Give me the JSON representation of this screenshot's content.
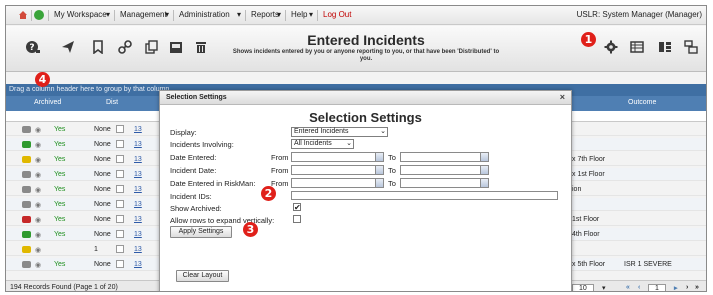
{
  "menu": {
    "items": [
      "My Workspace",
      "Management",
      "Administration",
      "Reports",
      "Help",
      "Log Out"
    ],
    "user": "USLR: System Manager (Manager)"
  },
  "toolbar": {
    "icons": [
      "help-icon",
      "send-icon",
      "bookmark-icon",
      "link-icon",
      "copy-icon",
      "inbox-icon",
      "delete-icon",
      "settings-icon",
      "grid-view-icon",
      "card-view-icon",
      "split-view-icon"
    ],
    "title": "Entered Incidents",
    "subtitle": "Shows incidents entered by you or anyone reporting to you, or that have been 'Distributed' to you."
  },
  "grid": {
    "group_hint": "Drag a column header here to group by that column",
    "columns": [
      "Archived",
      "Dist",
      "Outcome"
    ],
    "rows": [
      {
        "archived": "Yes",
        "dist": "None",
        "id": "13",
        "location": "",
        "outcome": "",
        "status": "gray"
      },
      {
        "archived": "Yes",
        "dist": "None",
        "id": "13",
        "location": "",
        "outcome": "",
        "status": "green"
      },
      {
        "archived": "Yes",
        "dist": "None",
        "id": "13",
        "location": "x 7th Floor",
        "outcome": "",
        "status": "yellow"
      },
      {
        "archived": "Yes",
        "dist": "None",
        "id": "13",
        "location": "x 1st Floor",
        "outcome": "",
        "status": "gray"
      },
      {
        "archived": "Yes",
        "dist": "None",
        "id": "13",
        "location": "ion",
        "outcome": "",
        "status": "gray"
      },
      {
        "archived": "Yes",
        "dist": "None",
        "id": "13",
        "location": "",
        "outcome": "",
        "status": "gray"
      },
      {
        "archived": "Yes",
        "dist": "None",
        "id": "13",
        "location": "1st Floor",
        "outcome": "",
        "status": "red"
      },
      {
        "archived": "Yes",
        "dist": "None",
        "id": "13",
        "location": "4th Floor",
        "outcome": "",
        "status": "green"
      },
      {
        "archived": "",
        "dist": "1",
        "id": "13",
        "location": "",
        "outcome": "",
        "status": "yellow"
      },
      {
        "archived": "Yes",
        "dist": "None",
        "id": "13",
        "location": "x 5th Floor",
        "outcome": "ISR 1 SEVERE",
        "status": "gray"
      }
    ],
    "footer_count": "194 Records Found (Page 1 of 20)",
    "page_size": "10",
    "current_page": "1"
  },
  "modal": {
    "header": "Selection Settings",
    "close": "×",
    "title": "Selection Settings",
    "fields": {
      "display_label": "Display:",
      "display_value": "Entered Incidents",
      "involving_label": "Incidents Involving:",
      "involving_value": "All Incidents",
      "date_entered_label": "Date Entered:",
      "incident_date_label": "Incident Date:",
      "date_riskman_label": "Date Entered in RiskMan:",
      "from": "From",
      "to": "To",
      "incident_ids_label": "Incident IDs:",
      "show_archived_label": "Show Archived:",
      "show_archived_checked": "✔",
      "expand_label": "Allow rows to expand vertically:"
    },
    "apply_label": "Apply Settings",
    "clear_label": "Clear Layout"
  },
  "badges": {
    "b1": "1",
    "b2": "2",
    "b3": "3",
    "b4": "4"
  },
  "colors": {
    "accent": "#4f7fb3",
    "badge": "#e0201a",
    "logout": "#c00000"
  }
}
